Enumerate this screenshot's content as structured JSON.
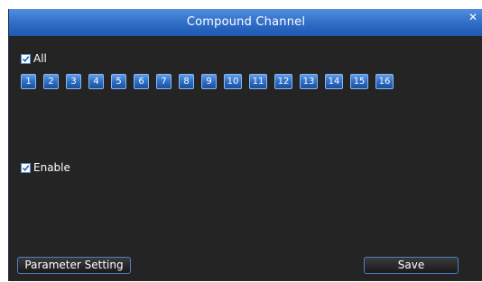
{
  "dialog": {
    "title": "Compound Channel",
    "close_glyph": "✕"
  },
  "all_checkbox": {
    "label": "All",
    "checked": true
  },
  "channels": [
    "1",
    "2",
    "3",
    "4",
    "5",
    "6",
    "7",
    "8",
    "9",
    "10",
    "11",
    "12",
    "13",
    "14",
    "15",
    "16"
  ],
  "enable_checkbox": {
    "label": "Enable",
    "checked": true
  },
  "footer": {
    "parameter_setting_label": "Parameter Setting",
    "save_label": "Save"
  },
  "colors": {
    "titlebar": "#2f6cc5",
    "panel_background": "#242424",
    "channel_button": "#2f6fc6"
  }
}
